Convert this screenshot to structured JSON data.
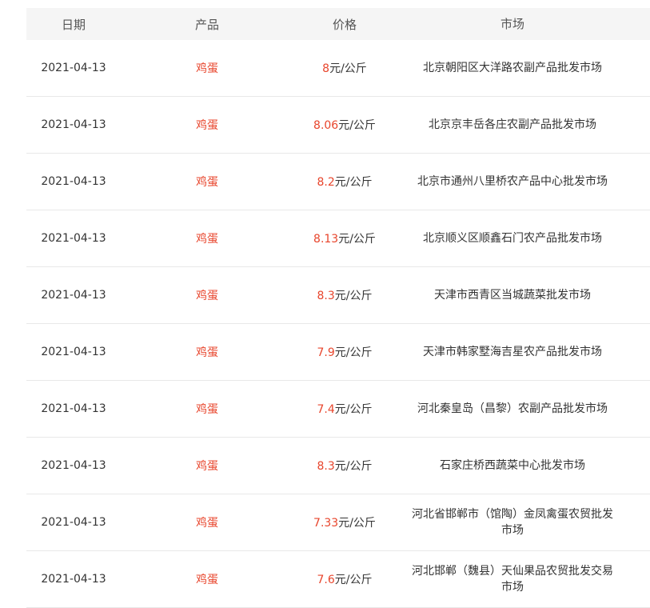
{
  "table": {
    "headers": {
      "date": "日期",
      "product": "产品",
      "price": "价格",
      "market": "市场"
    },
    "rows": [
      {
        "date": "2021-04-13",
        "product": "鸡蛋",
        "price": "8",
        "unit": "元/公斤",
        "market": "北京朝阳区大洋路农副产品批发市场"
      },
      {
        "date": "2021-04-13",
        "product": "鸡蛋",
        "price": "8.06",
        "unit": "元/公斤",
        "market": "北京京丰岳各庄农副产品批发市场"
      },
      {
        "date": "2021-04-13",
        "product": "鸡蛋",
        "price": "8.2",
        "unit": "元/公斤",
        "market": "北京市通州八里桥农产品中心批发市场"
      },
      {
        "date": "2021-04-13",
        "product": "鸡蛋",
        "price": "8.13",
        "unit": "元/公斤",
        "market": "北京顺义区顺鑫石门农产品批发市场"
      },
      {
        "date": "2021-04-13",
        "product": "鸡蛋",
        "price": "8.3",
        "unit": "元/公斤",
        "market": "天津市西青区当城蔬菜批发市场"
      },
      {
        "date": "2021-04-13",
        "product": "鸡蛋",
        "price": "7.9",
        "unit": "元/公斤",
        "market": "天津市韩家墅海吉星农产品批发市场"
      },
      {
        "date": "2021-04-13",
        "product": "鸡蛋",
        "price": "7.4",
        "unit": "元/公斤",
        "market": "河北秦皇岛（昌黎）农副产品批发市场"
      },
      {
        "date": "2021-04-13",
        "product": "鸡蛋",
        "price": "8.3",
        "unit": "元/公斤",
        "market": "石家庄桥西蔬菜中心批发市场"
      },
      {
        "date": "2021-04-13",
        "product": "鸡蛋",
        "price": "7.33",
        "unit": "元/公斤",
        "market": "河北省邯郸市（馆陶）金凤禽蛋农贸批发市场"
      },
      {
        "date": "2021-04-13",
        "product": "鸡蛋",
        "price": "7.6",
        "unit": "元/公斤",
        "market": "河北邯郸（魏县）天仙果品农贸批发交易市场"
      }
    ]
  },
  "colors": {
    "accent": "#e8452c",
    "header_bg": "#f5f5f5",
    "border": "#e8e8e8",
    "text": "#333333"
  }
}
